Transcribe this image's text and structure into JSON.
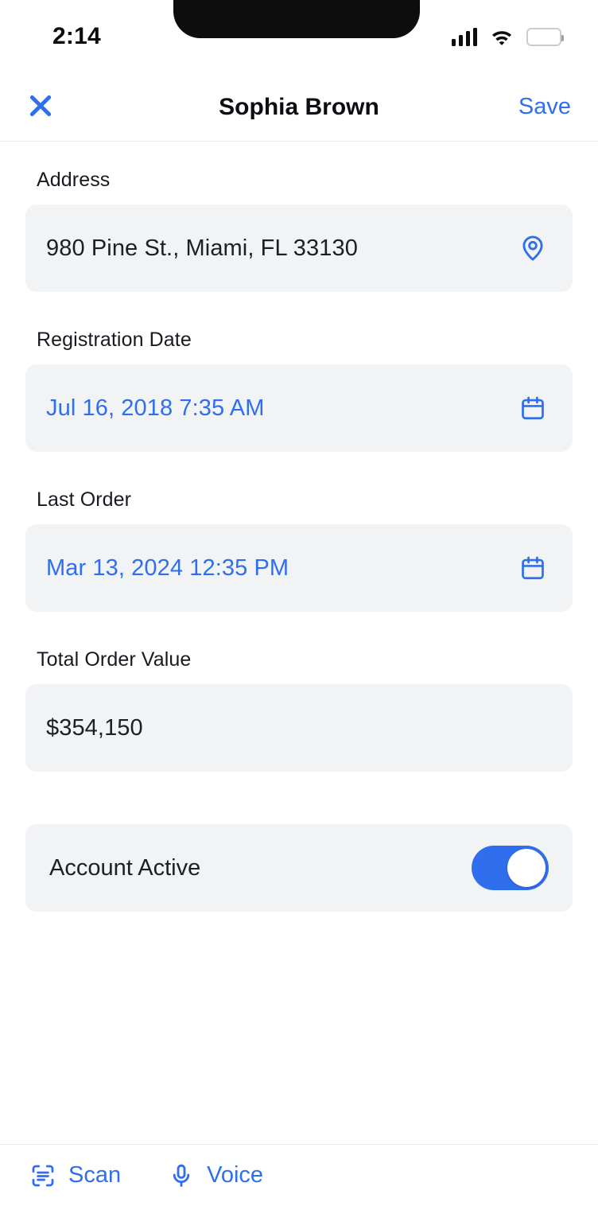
{
  "status_bar": {
    "time": "2:14",
    "signal_icon": "cellular-signal-icon",
    "wifi_icon": "wifi-icon",
    "battery_icon": "battery-full-icon"
  },
  "navbar": {
    "close_label": "✕",
    "close_icon": "close-icon",
    "title": "Sophia Brown",
    "save_label": "Save"
  },
  "form": {
    "fields": [
      {
        "label": "Address",
        "value": "980 Pine St., Miami, FL 33130",
        "icon": "map-pin-icon",
        "accent": false
      },
      {
        "label": "Registration Date",
        "value": "Jul 16, 2018 7:35 AM",
        "icon": "calendar-icon",
        "accent": true
      },
      {
        "label": "Last Order",
        "value": "Mar 13, 2024 12:35 PM",
        "icon": "calendar-icon",
        "accent": true
      },
      {
        "label": "Total Order Value",
        "value": "$354,150",
        "icon": null,
        "accent": false
      }
    ],
    "toggle": {
      "label": "Account Active",
      "state": "on"
    }
  },
  "toolbar": {
    "scan_label": "Scan",
    "scan_icon": "document-scan-icon",
    "voice_label": "Voice",
    "voice_icon": "microphone-icon"
  },
  "colors": {
    "accent": "#2f6fed",
    "field_bg": "#f2f3f5",
    "text": "#1c1f26",
    "divider": "#e8e9ee"
  }
}
